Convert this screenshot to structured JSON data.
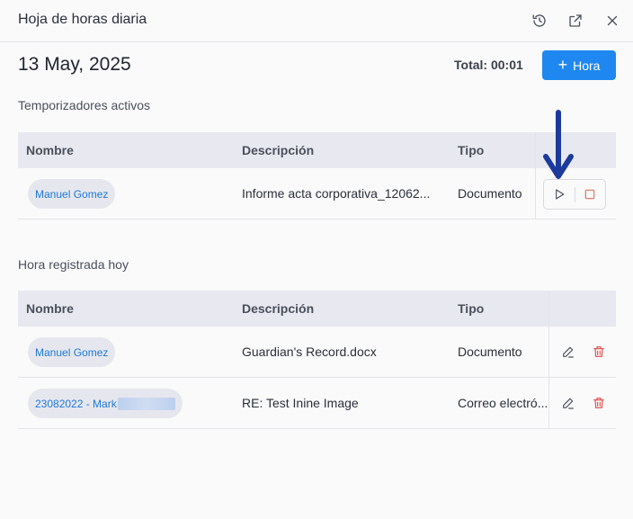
{
  "header": {
    "title": "Hoja de horas diaria"
  },
  "summary": {
    "date": "13 May, 2025",
    "total": "Total: 00:01",
    "add_label": "Hora"
  },
  "active_timers": {
    "title": "Temporizadores activos",
    "columns": [
      "Nombre",
      "Descripción",
      "Tipo"
    ],
    "rows": [
      {
        "name": "Manuel Gomez",
        "description": "Informe acta corporativa_12062...",
        "type": "Documento"
      }
    ]
  },
  "logged_today": {
    "title": "Hora registrada hoy",
    "columns": [
      "Nombre",
      "Descripción",
      "Tipo"
    ],
    "rows": [
      {
        "name": "Manuel Gomez",
        "description": "Guardian's Record.docx",
        "type": "Documento"
      },
      {
        "name": "23082022 - Mark",
        "description": "RE: Test Inine Image",
        "type": "Correo electró..."
      }
    ]
  },
  "colors": {
    "accent": "#1e88f0",
    "link": "#1e78d8",
    "delete": "#e04848",
    "stop": "#e86a5a",
    "annotation_arrow": "#1c3a9c",
    "table_header": "#e8e9f0"
  },
  "icons": {
    "history": "history-icon",
    "external": "external-link-icon",
    "close": "close-icon",
    "play": "play-icon",
    "stop": "stop-icon",
    "edit": "pencil-icon",
    "delete": "trash-icon"
  }
}
